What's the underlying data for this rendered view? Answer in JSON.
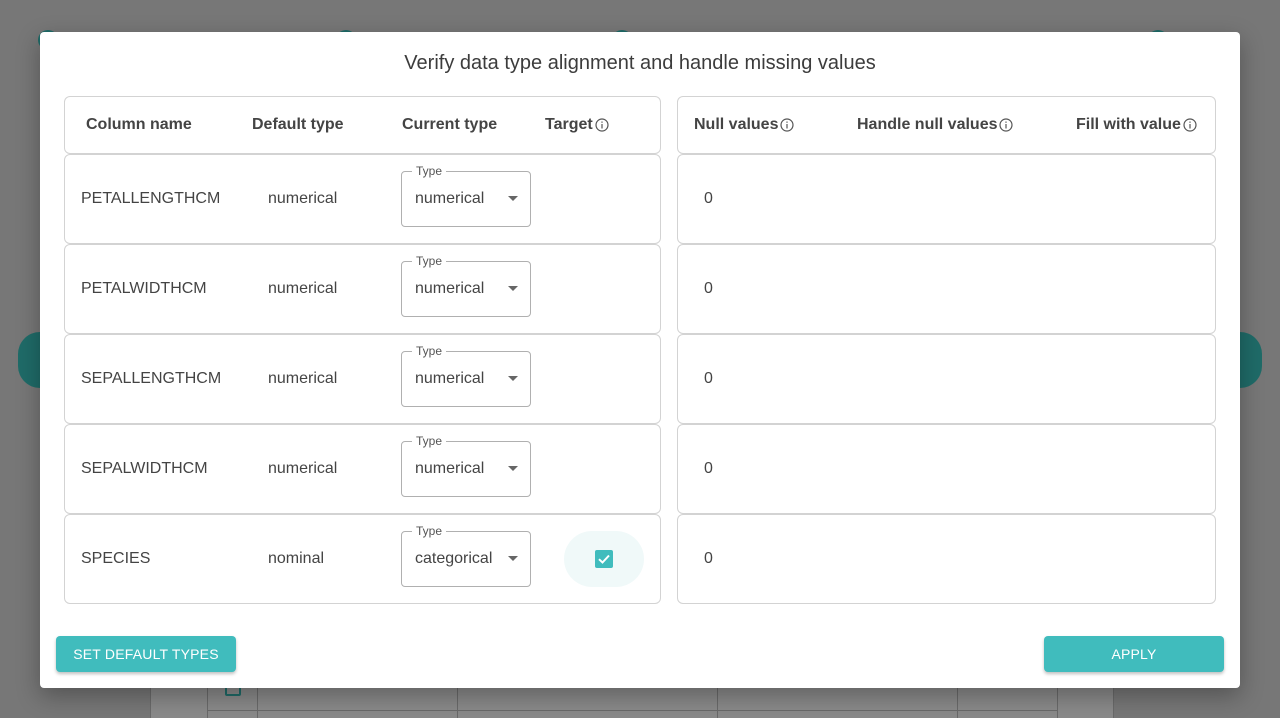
{
  "modal": {
    "title": "Verify data type alignment and handle missing values"
  },
  "left_table": {
    "headers": {
      "column_name": "Column name",
      "default_type": "Default type",
      "current_type": "Current type",
      "target": "Target"
    }
  },
  "right_table": {
    "headers": {
      "null_values": "Null values",
      "handle_null": "Handle null values",
      "fill_value": "Fill with value"
    }
  },
  "select_legend": "Type",
  "rows": [
    {
      "name": "PETALLENGTHCM",
      "default_type": "numerical",
      "current_type": "numerical",
      "target": false,
      "null_values": "0"
    },
    {
      "name": "PETALWIDTHCM",
      "default_type": "numerical",
      "current_type": "numerical",
      "target": false,
      "null_values": "0"
    },
    {
      "name": "SEPALLENGTHCM",
      "default_type": "numerical",
      "current_type": "numerical",
      "target": false,
      "null_values": "0"
    },
    {
      "name": "SEPALWIDTHCM",
      "default_type": "numerical",
      "current_type": "numerical",
      "target": false,
      "null_values": "0"
    },
    {
      "name": "SPECIES",
      "default_type": "nominal",
      "current_type": "categorical",
      "target": true,
      "null_values": "0"
    }
  ],
  "buttons": {
    "set_default": "SET DEFAULT TYPES",
    "apply": "APPLY"
  },
  "colors": {
    "accent": "#40bcbd",
    "overlay": "#777777"
  }
}
